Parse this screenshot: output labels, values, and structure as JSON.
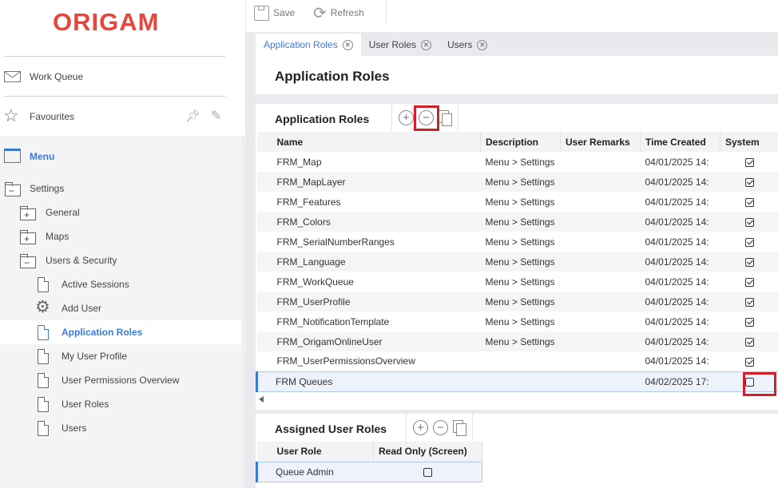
{
  "brand": {
    "logo_text": "ORIGAM"
  },
  "sidebar": {
    "work_queue": "Work Queue",
    "favourites": "Favourites",
    "menu": "Menu",
    "tree": [
      {
        "label": "Settings",
        "type": "folder",
        "level": 0
      },
      {
        "label": "General",
        "type": "folder",
        "level": 1
      },
      {
        "label": "Maps",
        "type": "folder",
        "level": 1
      },
      {
        "label": "Users & Security",
        "type": "folder",
        "level": 1
      },
      {
        "label": "Active Sessions",
        "type": "doc",
        "level": 2
      },
      {
        "label": "Add User",
        "type": "gear",
        "level": 2
      },
      {
        "label": "Application Roles",
        "type": "doc",
        "level": 2,
        "active": true
      },
      {
        "label": "My User Profile",
        "type": "doc",
        "level": 2
      },
      {
        "label": "User Permissions Overview",
        "type": "doc",
        "level": 2
      },
      {
        "label": "User Roles",
        "type": "doc",
        "level": 2
      },
      {
        "label": "Users",
        "type": "doc",
        "level": 2
      }
    ]
  },
  "toolbar": {
    "save_label": "Save",
    "refresh_label": "Refresh"
  },
  "tabs": [
    {
      "label": "Application Roles",
      "active": true
    },
    {
      "label": "User Roles",
      "active": false
    },
    {
      "label": "Users",
      "active": false
    }
  ],
  "page": {
    "title": "Application Roles"
  },
  "roles_panel": {
    "title": "Application Roles",
    "columns": [
      "Name",
      "Description",
      "User Remarks",
      "Time Created",
      "System"
    ],
    "rows": [
      {
        "name": "FRM_Map",
        "description": "Menu > Settings",
        "remarks": "",
        "time": "04/01/2025 14:",
        "system": true
      },
      {
        "name": "FRM_MapLayer",
        "description": "Menu > Settings",
        "remarks": "",
        "time": "04/01/2025 14:",
        "system": true
      },
      {
        "name": "FRM_Features",
        "description": "Menu > Settings",
        "remarks": "",
        "time": "04/01/2025 14:",
        "system": true
      },
      {
        "name": "FRM_Colors",
        "description": "Menu > Settings",
        "remarks": "",
        "time": "04/01/2025 14:",
        "system": true
      },
      {
        "name": "FRM_SerialNumberRanges",
        "description": "Menu > Settings",
        "remarks": "",
        "time": "04/01/2025 14:",
        "system": true
      },
      {
        "name": "FRM_Language",
        "description": "Menu > Settings",
        "remarks": "",
        "time": "04/01/2025 14:",
        "system": true
      },
      {
        "name": "FRM_WorkQueue",
        "description": "Menu > Settings",
        "remarks": "",
        "time": "04/01/2025 14:",
        "system": true
      },
      {
        "name": "FRM_UserProfile",
        "description": "Menu > Settings",
        "remarks": "",
        "time": "04/01/2025 14:",
        "system": true
      },
      {
        "name": "FRM_NotificationTemplate",
        "description": "Menu > Settings",
        "remarks": "",
        "time": "04/01/2025 14:",
        "system": true
      },
      {
        "name": "FRM_OrigamOnlineUser",
        "description": "Menu > Settings",
        "remarks": "",
        "time": "04/01/2025 14:",
        "system": true
      },
      {
        "name": "FRM_UserPermissionsOverview",
        "description": "",
        "remarks": "",
        "time": "04/01/2025 14:",
        "system": true
      },
      {
        "name": "FRM Queues",
        "description": "",
        "remarks": "",
        "time": "04/02/2025 17:",
        "system": false,
        "selected": true
      }
    ]
  },
  "assigned_panel": {
    "title": "Assigned User Roles",
    "columns": [
      "User Role",
      "Read Only (Screen)"
    ],
    "rows": [
      {
        "role": "Queue Admin",
        "read_only": false
      }
    ]
  }
}
